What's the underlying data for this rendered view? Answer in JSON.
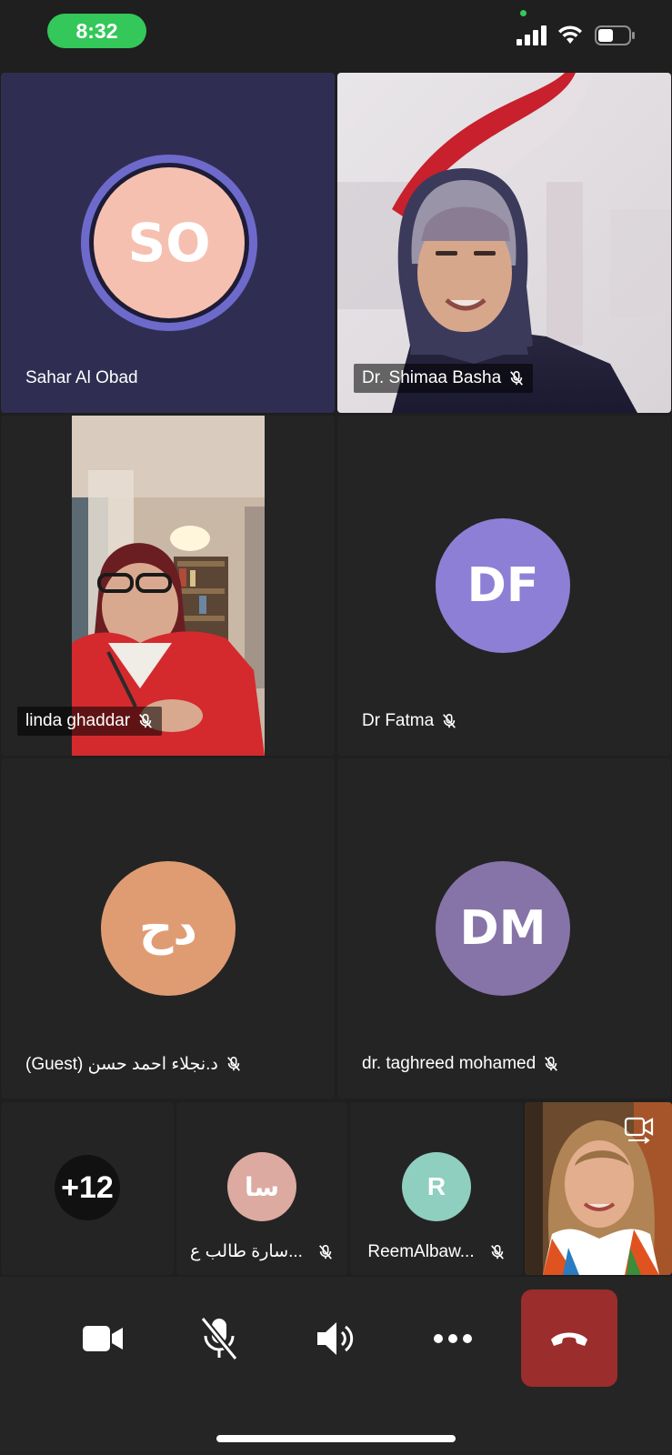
{
  "status_bar": {
    "time": "8:32"
  },
  "tiles": [
    {
      "name": "Sahar Al Obad",
      "initials": "SO",
      "avatar_color": "#f6c0b0",
      "ring_color": "#6e6acb",
      "muted": false
    },
    {
      "name": "Dr. Shimaa Basha",
      "muted": true,
      "video": true
    },
    {
      "name": "linda ghaddar",
      "muted": true,
      "video": true
    },
    {
      "name": "Dr Fatma",
      "initials": "DF",
      "avatar_color": "#8e7fd6",
      "muted": true
    },
    {
      "name": "(Guest)  د.نجلاء احمد حسن",
      "initials": "دح",
      "avatar_color": "#df9c73",
      "muted": true
    },
    {
      "name": "dr. taghreed mohamed",
      "initials": "DM",
      "avatar_color": "#8673a8",
      "muted": true
    }
  ],
  "strip": [
    {
      "label": "+12",
      "type": "more"
    },
    {
      "name": "سارة طالب ع...",
      "initials": "سا",
      "avatar_color": "#dcaaa0",
      "muted": true
    },
    {
      "name": "ReemAlbaw...",
      "initials": "R",
      "avatar_color": "#8fcfbf",
      "muted": true
    },
    {
      "name": "self-view",
      "video": true
    }
  ],
  "toolbar": {
    "buttons": [
      "video-camera-icon",
      "microphone-muted-icon",
      "speaker-icon",
      "more-icon",
      "hang-up-icon"
    ],
    "hangup_color": "#9b2d2d"
  },
  "colors": {
    "background": "#1f1f1f",
    "tile": "#242424",
    "first_tile": "#2f2e52",
    "status_pill": "#34c759"
  }
}
